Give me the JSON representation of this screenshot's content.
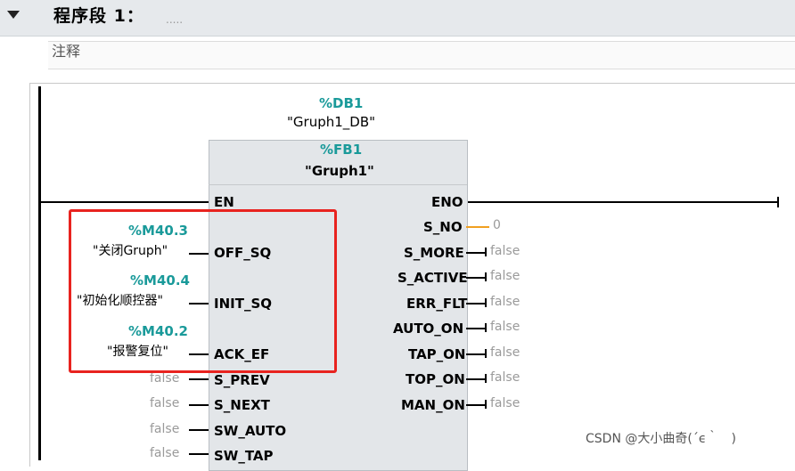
{
  "network": {
    "title": "程序段 1：",
    "title_placeholder": ".....",
    "comment_label": "注释"
  },
  "instance": {
    "db_address": "%DB1",
    "db_name": "\"Gruph1_DB\"",
    "fb_address": "%FB1",
    "fb_name": "\"Gruph1\""
  },
  "inputs": [
    {
      "pin": "EN"
    },
    {
      "pin": "OFF_SQ",
      "address": "%M40.3",
      "symbol": "\"关闭Gruph\""
    },
    {
      "pin": "INIT_SQ",
      "address": "%M40.4",
      "symbol": "\"初始化顺控器\""
    },
    {
      "pin": "ACK_EF",
      "address": "%M40.2",
      "symbol": "\"报警复位\""
    },
    {
      "pin": "S_PREV",
      "value": "false"
    },
    {
      "pin": "S_NEXT",
      "value": "false"
    },
    {
      "pin": "SW_AUTO",
      "value": "false"
    },
    {
      "pin": "SW_TAP",
      "value": "false"
    }
  ],
  "outputs": [
    {
      "pin": "ENO"
    },
    {
      "pin": "S_NO",
      "value": "0"
    },
    {
      "pin": "S_MORE",
      "value": "false"
    },
    {
      "pin": "S_ACTIVE",
      "value": "false"
    },
    {
      "pin": "ERR_FLT",
      "value": "false"
    },
    {
      "pin": "AUTO_ON",
      "value": "false"
    },
    {
      "pin": "TAP_ON",
      "value": "false"
    },
    {
      "pin": "TOP_ON",
      "value": "false"
    },
    {
      "pin": "MAN_ON",
      "value": "false"
    }
  ],
  "colors": {
    "address": "#1a9a9a",
    "highlight": "#e8231f",
    "s_no_line": "#f0a020",
    "default_value": "#9a9a9a"
  },
  "watermark": "CSDN @大小曲奇(´ϵ｀　)"
}
